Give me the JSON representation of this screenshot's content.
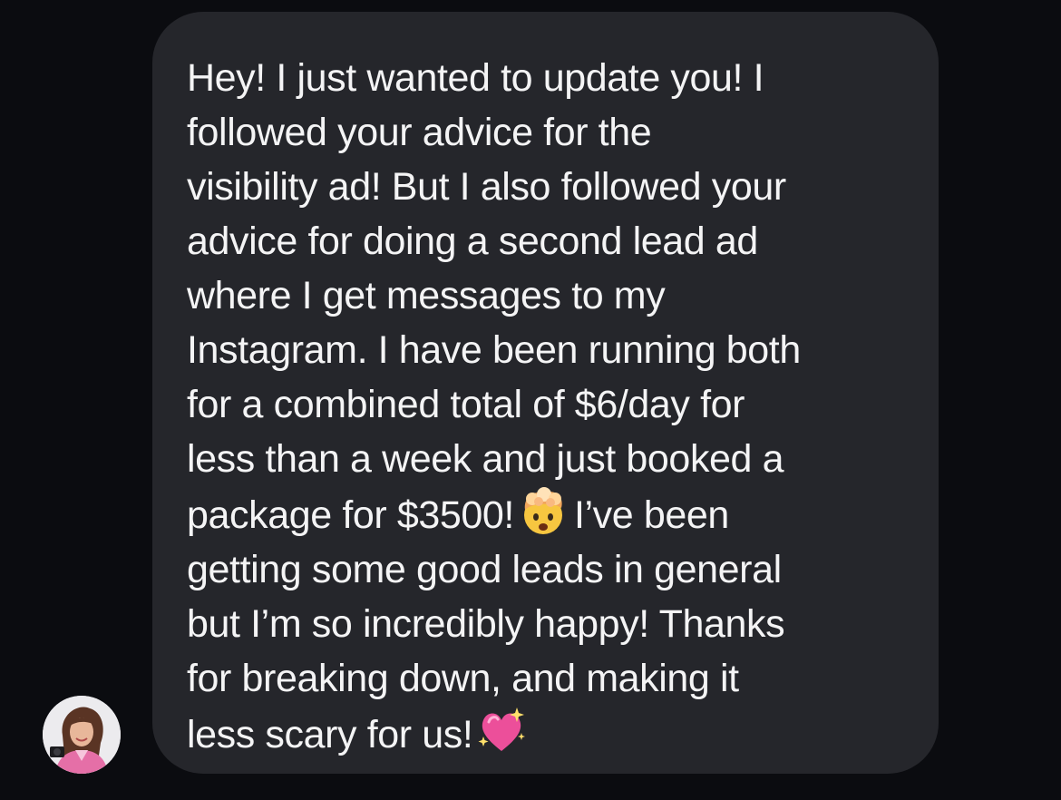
{
  "message": {
    "lines": [
      "Hey! I just wanted to update you! I",
      "followed your advice for the",
      "visibility ad! But I also followed your",
      "advice for doing a second lead ad",
      "where I get messages to my",
      "Instagram. I have been running both",
      "for a combined total of $6/day for",
      "less than a week and just booked a"
    ],
    "line9_before_emoji": "package for $3500!",
    "line9_after_emoji": "I’ve been",
    "lines_after": [
      "getting some good leads in general",
      "but I’m so incredibly happy! Thanks",
      "for breaking down, and making it"
    ],
    "last_line_text": "less scary for us!",
    "emoji_1": "exploding-head-emoji",
    "emoji_2": "sparkling-heart-emoji"
  },
  "sender": {
    "avatar_icon": "profile-photo"
  },
  "colors": {
    "background": "#0b0c10",
    "bubble": "#25262b",
    "text": "#f4f4f5"
  }
}
